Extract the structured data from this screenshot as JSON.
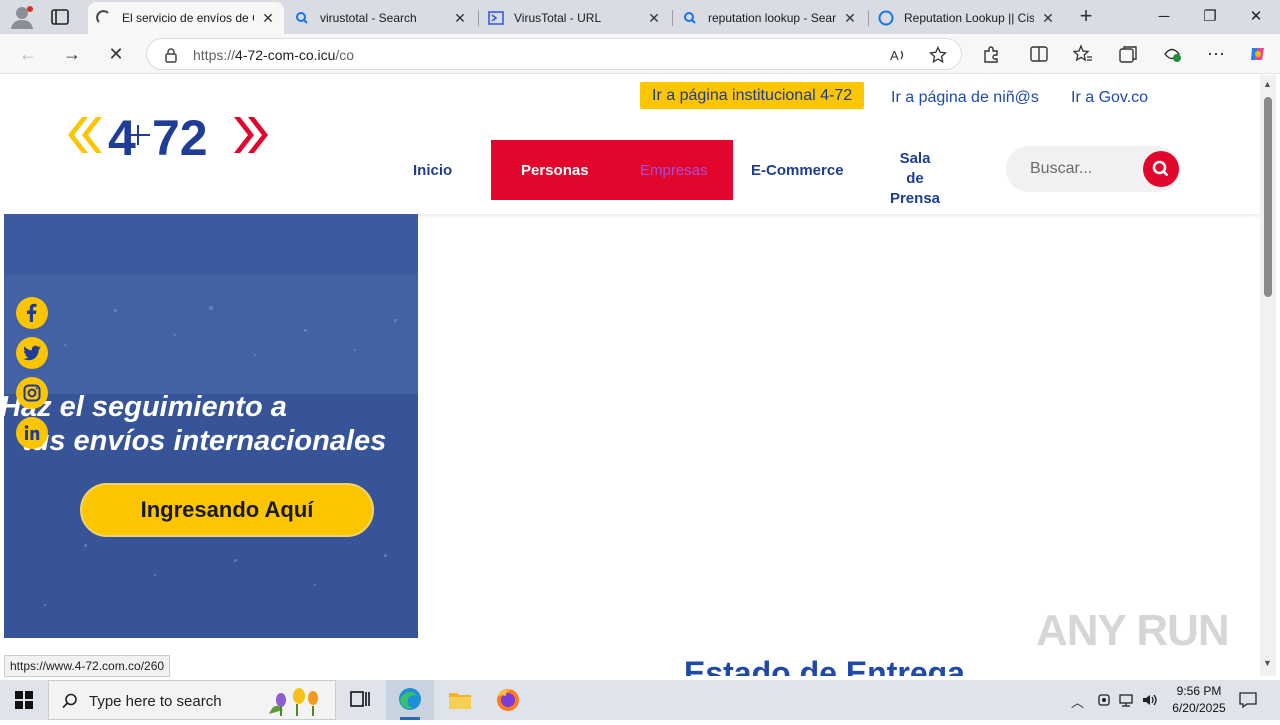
{
  "browser": {
    "tabs": [
      {
        "title": "El servicio de envíos de C",
        "active": true,
        "icon": "loading-spinner-icon"
      },
      {
        "title": "virustotal - Search",
        "active": false,
        "icon": "search-icon"
      },
      {
        "title": "VirusTotal - URL",
        "active": false,
        "icon": "virustotal-icon"
      },
      {
        "title": "reputation lookup - Searc",
        "active": false,
        "icon": "search-icon"
      },
      {
        "title": "Reputation Lookup || Cisc",
        "active": false,
        "icon": "cisco-icon"
      }
    ],
    "url": "https://4-72-com-co.icu/co",
    "url_host": "4-72-com-co.icu",
    "url_scheme": "https://",
    "url_path": "/co",
    "status_url": "https://www.4-72.com.co/260"
  },
  "site": {
    "logo_text": "4-72",
    "institucional_button": "Ir a página institucional 4-72",
    "top_links": [
      "Ir a página de niñ@s",
      "Ir a Gov.co"
    ],
    "nav": {
      "inicio": "Inicio",
      "personas": "Personas",
      "empresas": "Empresas",
      "ecommerce": "E-Commerce",
      "sala_line1": "Sala",
      "sala_line2": "de",
      "sala_line3": "Prensa"
    },
    "search_placeholder": "Buscar...",
    "banner": {
      "headline_line1": "Haz el seguimiento a",
      "headline_line2": "tus envíos internacionales",
      "cta": "Ingresando Aquí"
    },
    "social": [
      "facebook-icon",
      "twitter-icon",
      "instagram-icon",
      "linkedin-icon"
    ],
    "section_title": "Estado de Entrega",
    "colors": {
      "yellow": "#fbc500",
      "red": "#e2062c",
      "blue": "#1f3c96"
    }
  },
  "watermark": "ANY RUN",
  "taskbar": {
    "search_placeholder": "Type here to search",
    "time": "9:56 PM",
    "date": "6/20/2025"
  }
}
